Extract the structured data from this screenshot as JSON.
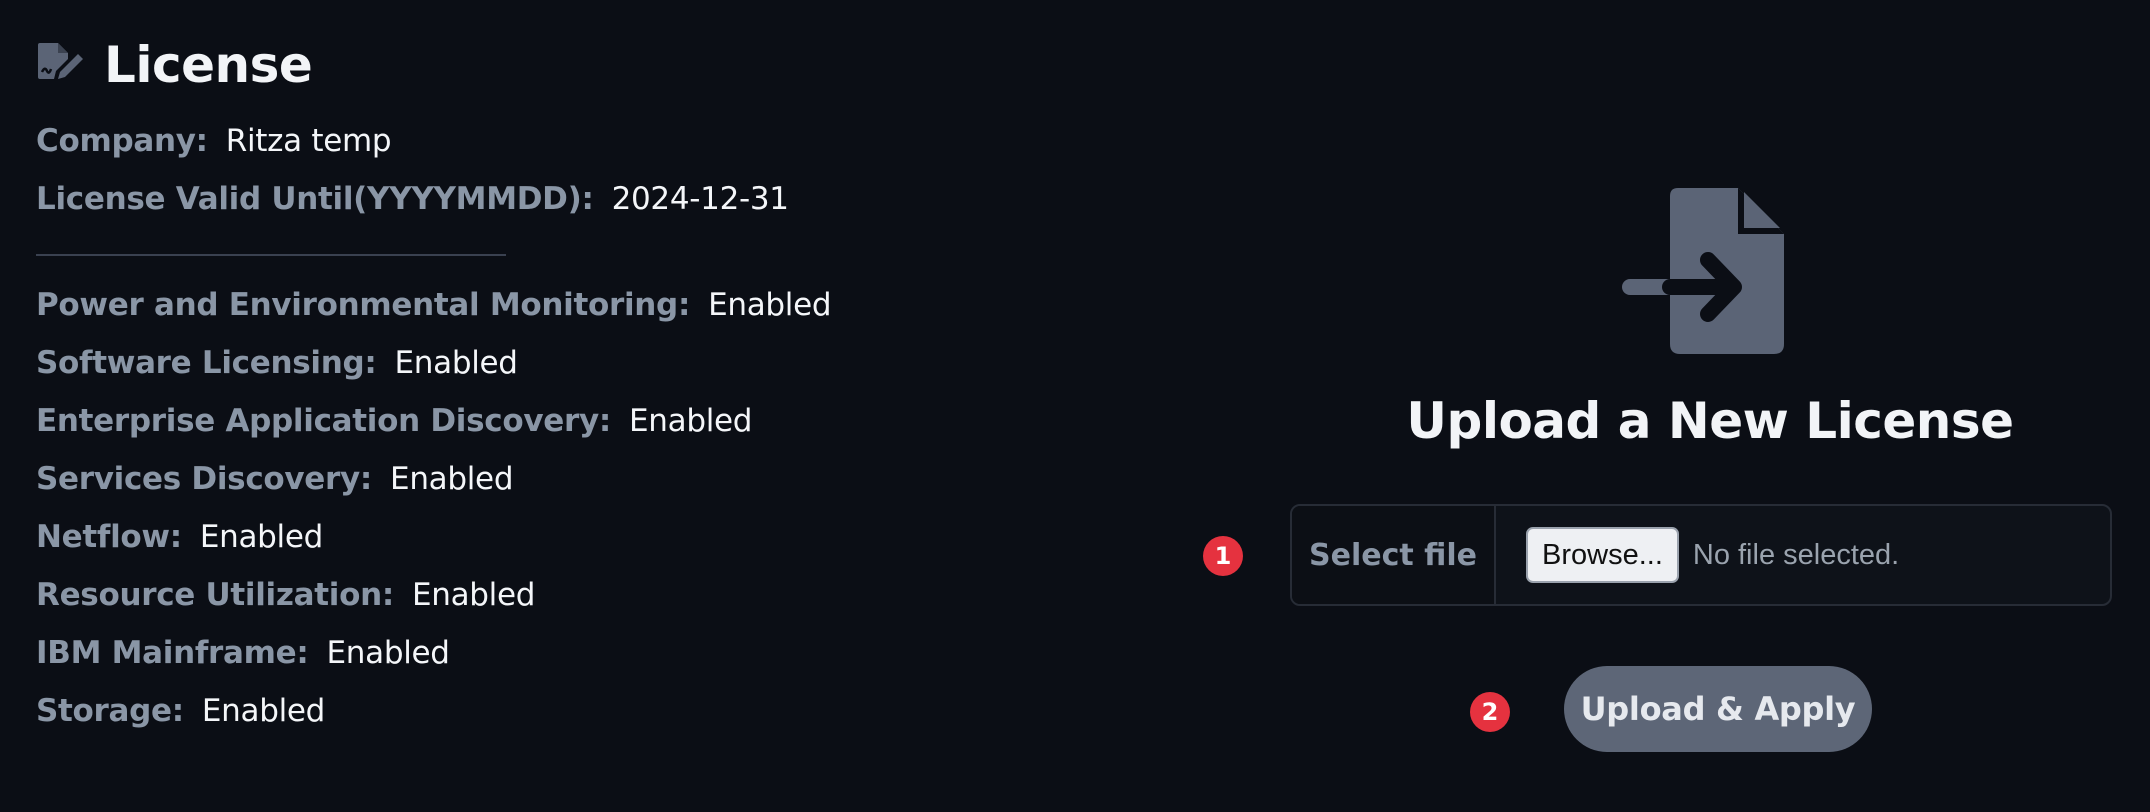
{
  "license": {
    "title": "License",
    "company_label": "Company:",
    "company_value": "Ritza temp",
    "valid_label": "License Valid Until(YYYYMMDD):",
    "valid_value": "2024-12-31",
    "features": [
      {
        "label": "Power and Environmental Monitoring:",
        "value": "Enabled"
      },
      {
        "label": "Software Licensing:",
        "value": "Enabled"
      },
      {
        "label": "Enterprise Application Discovery:",
        "value": "Enabled"
      },
      {
        "label": "Services Discovery:",
        "value": "Enabled"
      },
      {
        "label": "Netflow:",
        "value": "Enabled"
      },
      {
        "label": "Resource Utilization:",
        "value": "Enabled"
      },
      {
        "label": "IBM Mainframe:",
        "value": "Enabled"
      },
      {
        "label": "Storage:",
        "value": "Enabled"
      }
    ]
  },
  "upload": {
    "title": "Upload a New License",
    "select_file_label": "Select file",
    "browse_label": "Browse...",
    "no_file_text": "No file selected.",
    "button_label": "Upload & Apply",
    "step_1": "1",
    "step_2": "2"
  },
  "icons": {
    "title_icon": "file-signature-icon",
    "upload_icon": "file-import-icon"
  },
  "colors": {
    "background": "#0b0e15",
    "label": "#8a96a6",
    "value": "#f4f6f9",
    "badge": "#e5323f",
    "button": "#5d6677",
    "icon": "#5b6476"
  }
}
